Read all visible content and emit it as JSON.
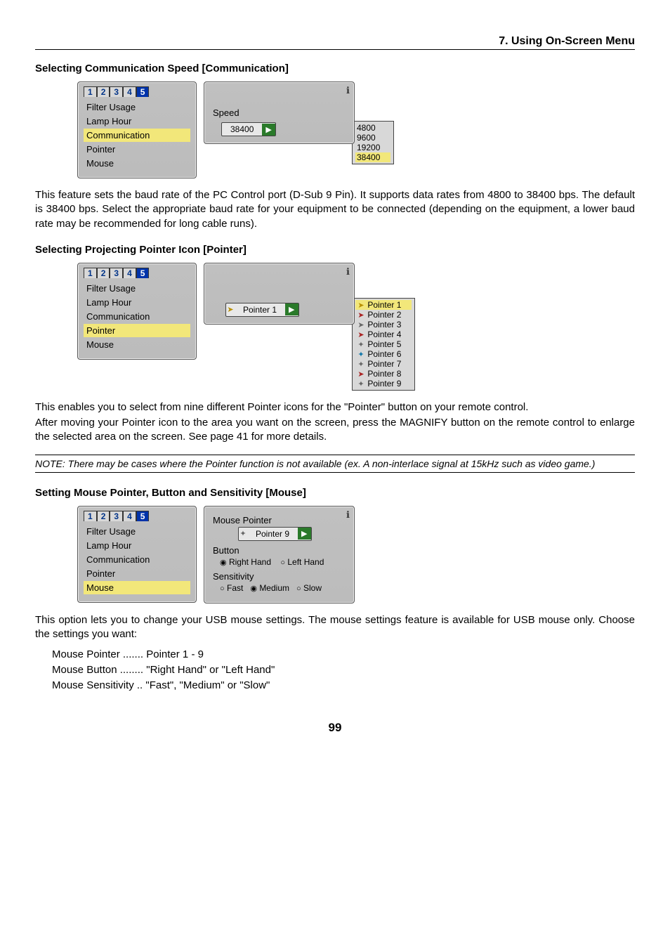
{
  "chapter_header": "7. Using On-Screen Menu",
  "page_number": "99",
  "section_comm": {
    "title": "Selecting Communication Speed [Communication]",
    "body": "This feature sets the baud rate of the PC Control port (D-Sub 9 Pin). It supports data rates from 4800 to 38400 bps. The default is 38400 bps. Select the appropriate baud rate for your equipment to be connected (depending on the equipment, a lower baud rate may be recommended for long cable runs).",
    "sidebar_tabs": [
      "1",
      "2",
      "3",
      "4",
      "5"
    ],
    "sidebar_items": [
      "Filter Usage",
      "Lamp Hour",
      "Communication",
      "Pointer",
      "Mouse"
    ],
    "sidebar_highlight": "Communication",
    "speed_label": "Speed",
    "combo_value": "38400",
    "dropdown": [
      "4800",
      "9600",
      "19200",
      "38400"
    ],
    "dropdown_selected": "38400"
  },
  "section_pointer": {
    "title": "Selecting Projecting Pointer Icon [Pointer]",
    "body1": "This enables you to select from nine different Pointer icons for the \"Pointer\" button on your remote control.",
    "body2": "After moving your Pointer icon to the area you want on the screen, press the MAGNIFY button on the remote control to enlarge the selected area on the screen. See page 41 for more details.",
    "note": "NOTE: There may be cases where the Pointer function is not available (ex. A non-interlace signal at 15kHz such as video game.)",
    "sidebar_items": [
      "Filter Usage",
      "Lamp Hour",
      "Communication",
      "Pointer",
      "Mouse"
    ],
    "sidebar_highlight": "Pointer",
    "combo_value": "Pointer 1",
    "dropdown": [
      "Pointer 1",
      "Pointer 2",
      "Pointer 3",
      "Pointer 4",
      "Pointer 5",
      "Pointer 6",
      "Pointer 7",
      "Pointer 8",
      "Pointer 9"
    ],
    "dropdown_selected": "Pointer 1"
  },
  "section_mouse": {
    "title": "Setting Mouse Pointer, Button and Sensitivity [Mouse]",
    "body": "This option lets you to change your USB mouse settings. The mouse settings feature is available for USB mouse only. Choose the settings you want:",
    "list_pointer_label": "Mouse Pointer .......",
    "list_pointer_value": "Pointer 1 - 9",
    "list_button_label": "Mouse Button ........",
    "list_button_value": "\"Right Hand\" or \"Left Hand\"",
    "list_sens_label": "Mouse Sensitivity ..",
    "list_sens_value": "\"Fast\", \"Medium\" or \"Slow\"",
    "sidebar_items": [
      "Filter Usage",
      "Lamp Hour",
      "Communication",
      "Pointer",
      "Mouse"
    ],
    "sidebar_highlight": "Mouse",
    "grp_mouse_pointer": "Mouse Pointer",
    "combo_value": "Pointer 9",
    "grp_button": "Button",
    "button_options": [
      "Right Hand",
      "Left Hand"
    ],
    "button_selected": "Right Hand",
    "grp_sens": "Sensitivity",
    "sens_options": [
      "Fast",
      "Medium",
      "Slow"
    ],
    "sens_selected": "Medium"
  }
}
